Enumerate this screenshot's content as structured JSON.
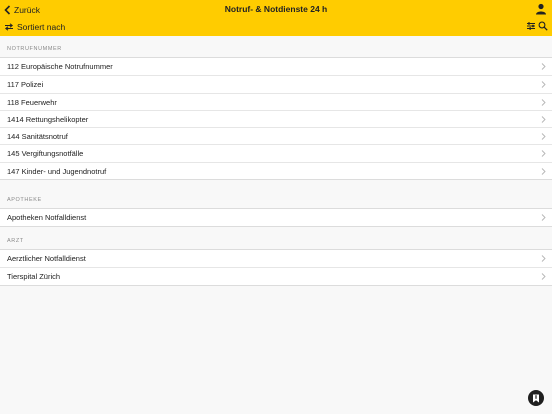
{
  "header": {
    "back_label": "Zurück",
    "title": "Notruf- & Notdienste 24 h",
    "sort_label": "Sortiert nach"
  },
  "sections": [
    {
      "title": "NOTRUFNUMMER",
      "items": [
        "112 Europäische Notrufnummer",
        "117 Polizei",
        "118 Feuerwehr",
        "1414 Rettungshelikopter",
        "144 Sanitätsnotruf",
        "145 Vergiftungsnotfälle",
        "147 Kinder- und Jugendnotruf"
      ]
    },
    {
      "title": "APOTHEKE",
      "items": [
        "Apotheken Notfalldienst"
      ]
    },
    {
      "title": "ARZT",
      "items": [
        "Aerztlicher Notfalldienst",
        "Tierspital Zürich"
      ]
    }
  ],
  "colors": {
    "header_bg": "#ffcc00",
    "page_bg": "#f8f8f8",
    "fab_bg": "#1f1f1f"
  },
  "icons": {
    "back": "chevron-left-icon",
    "user": "user-icon",
    "sort": "sort-arrows-icon",
    "filter": "filter-sliders-icon",
    "search": "search-icon",
    "row": "chevron-right-icon",
    "fab": "bookmark-icon"
  }
}
